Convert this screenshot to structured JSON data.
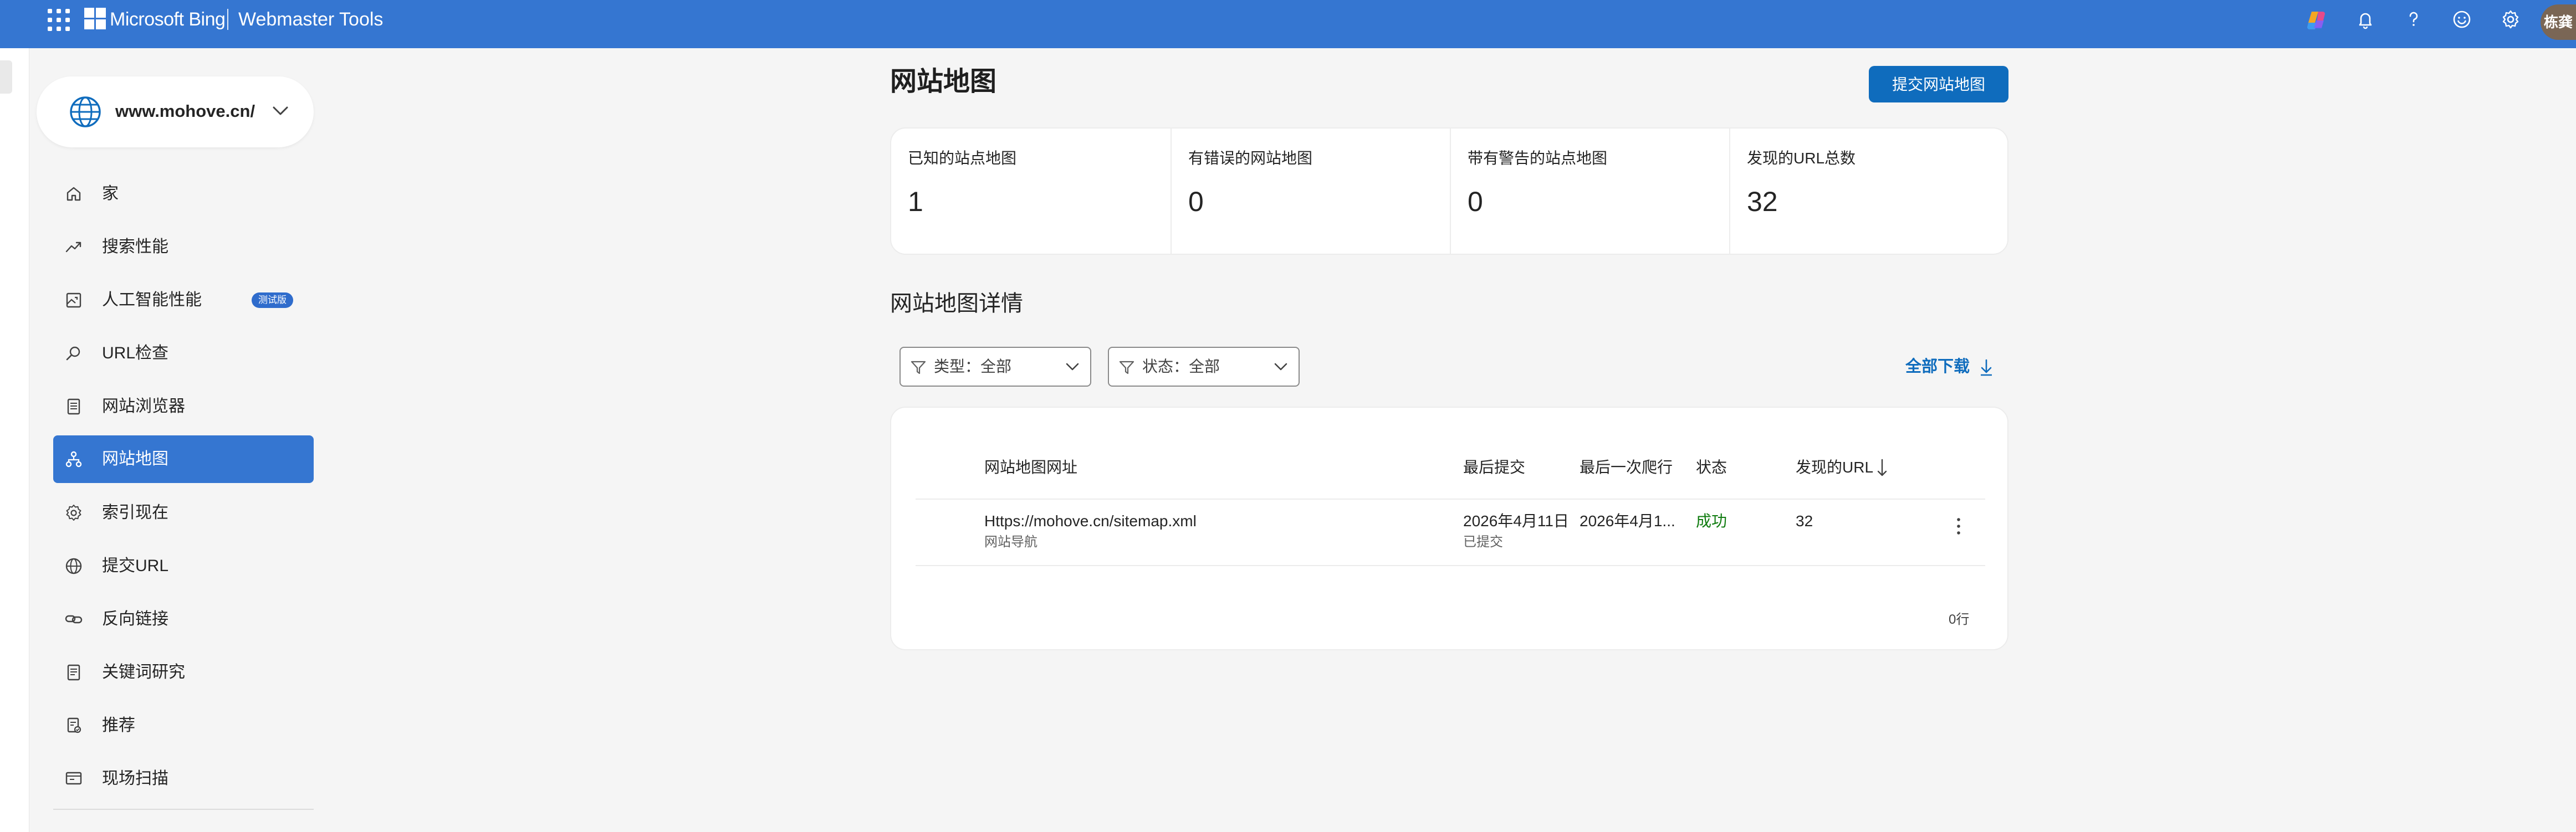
{
  "topbar": {
    "brand": "Microsoft Bing",
    "product": "Webmaster Tools",
    "avatar_text": "栋龚"
  },
  "site": {
    "name": "www.mohove.cn/"
  },
  "sidebar": {
    "items": [
      {
        "label": "家",
        "icon": "home-icon"
      },
      {
        "label": "搜索性能",
        "icon": "trend-icon"
      },
      {
        "label": "人工智能性能",
        "icon": "image-chart-icon",
        "badge": "测试版"
      },
      {
        "label": "URL检查",
        "icon": "search-icon"
      },
      {
        "label": "网站浏览器",
        "icon": "document-icon"
      },
      {
        "label": "网站地图",
        "icon": "sitemap-icon",
        "active": true
      },
      {
        "label": "索引现在",
        "icon": "gear-icon"
      },
      {
        "label": "提交URL",
        "icon": "globe-icon"
      },
      {
        "label": "反向链接",
        "icon": "link-icon"
      },
      {
        "label": "关键词研究",
        "icon": "document-icon"
      },
      {
        "label": "推荐",
        "icon": "recommend-icon"
      },
      {
        "label": "现场扫描",
        "icon": "scan-icon"
      }
    ]
  },
  "main": {
    "title": "网站地图",
    "submit_button": "提交网站地图",
    "stats": [
      {
        "label": "已知的站点地图",
        "value": "1"
      },
      {
        "label": "有错误的网站地图",
        "value": "0"
      },
      {
        "label": "带有警告的站点地图",
        "value": "0"
      },
      {
        "label": "发现的URL总数",
        "value": "32"
      }
    ],
    "details_title": "网站地图详情",
    "filters": [
      {
        "label": "类型：全部"
      },
      {
        "label": "状态：全部"
      }
    ],
    "download_label": "全部下载",
    "table": {
      "columns": [
        "网站地图网址",
        "最后提交",
        "最后一次爬行",
        "状态",
        "发现的URL"
      ],
      "rows": [
        {
          "url": "Https://mohove.cn/sitemap.xml",
          "url_sub": "网站导航",
          "last_submitted": "2026年4月11日",
          "last_submitted_sub": "已提交",
          "last_crawled": "2026年4月1...",
          "status": "成功",
          "discovered": "32"
        }
      ],
      "row_count": "0行"
    }
  },
  "colors": {
    "topbar": "#3576d1",
    "accent": "#0f6cbd",
    "success": "#107c10"
  }
}
